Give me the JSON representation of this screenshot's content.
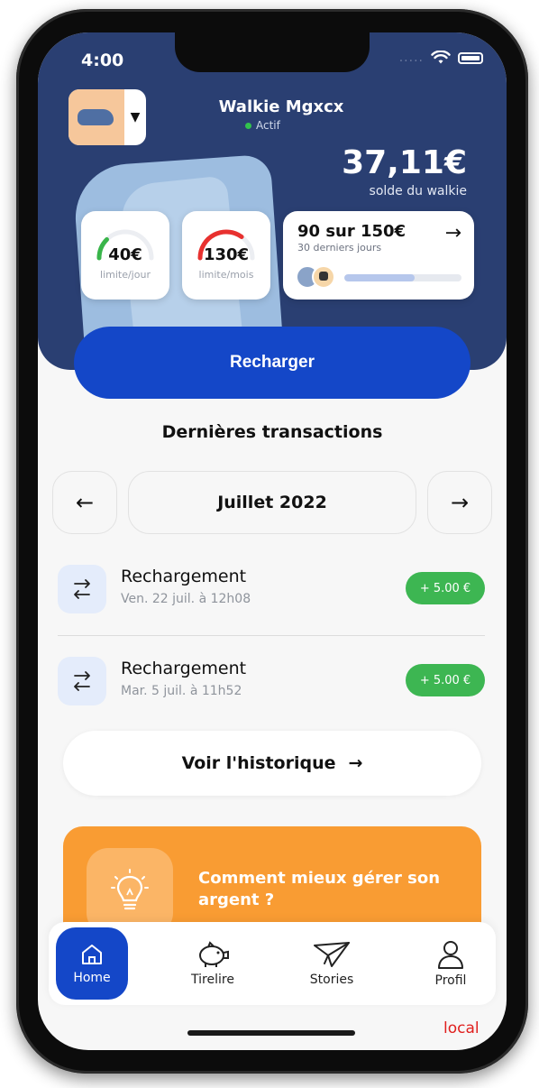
{
  "status_bar": {
    "time": "4:00",
    "signal": "....."
  },
  "header": {
    "walkie_name": "Walkie Mgxcx",
    "walkie_status": "Actif",
    "balance": "37,11€",
    "balance_label": "solde du walkie"
  },
  "limits": {
    "day": {
      "value": "40€",
      "label": "limite/jour",
      "used_fraction": 0.25,
      "arc_color": "#39b54a"
    },
    "month": {
      "value": "130€",
      "label": "limite/mois",
      "used_fraction": 0.7,
      "arc_color": "#e8312f"
    }
  },
  "progress": {
    "title": "90 sur 150€",
    "subtitle": "30 derniers jours",
    "fraction": 0.6,
    "arrow_icon": "arrow-right-icon"
  },
  "actions": {
    "recharge_label": "Recharger"
  },
  "transactions": {
    "section_title": "Dernières transactions",
    "month_label": "Juillet 2022",
    "prev_icon": "arrow-left-icon",
    "next_icon": "arrow-right-icon",
    "items": [
      {
        "title": "Rechargement",
        "date": "Ven. 22 juil. à 12h08",
        "amount": "+ 5.00 €"
      },
      {
        "title": "Rechargement",
        "date": "Mar. 5 juil. à 11h52",
        "amount": "+ 5.00 €"
      }
    ],
    "history_label": "Voir l'historique"
  },
  "tip": {
    "text": "Comment mieux gérer son argent ?",
    "icon": "lightbulb-icon"
  },
  "bottom_nav": {
    "items": [
      {
        "label": "Home",
        "icon": "home-icon"
      },
      {
        "label": "Tirelire",
        "icon": "piggy-bank-icon"
      },
      {
        "label": "Stories",
        "icon": "paper-plane-icon"
      },
      {
        "label": "Profil",
        "icon": "user-icon"
      }
    ]
  },
  "environment_label": "local",
  "colors": {
    "header_bg": "#2a3f72",
    "primary": "#1447c8",
    "success": "#3db652",
    "tip_bg": "#f99c33"
  }
}
